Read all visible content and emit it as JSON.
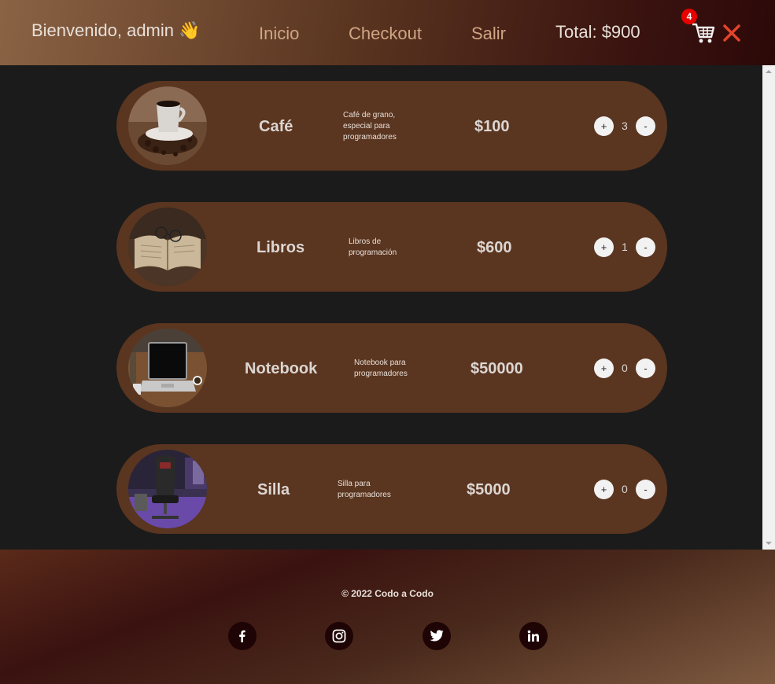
{
  "header": {
    "welcome": "Bienvenido, admin 👋",
    "nav": [
      "Inicio",
      "Checkout",
      "Salir"
    ],
    "total": "Total: $900",
    "cart_count": "4"
  },
  "products": [
    {
      "name": "Café",
      "description": "Café de grano, especial para programadores",
      "price": "$100",
      "qty": "3",
      "image": "coffee-cup-image"
    },
    {
      "name": "Libros",
      "description": "Libros de programación",
      "price": "$600",
      "qty": "1",
      "image": "open-book-image"
    },
    {
      "name": "Notebook",
      "description": "Notebook para programadores",
      "price": "$50000",
      "qty": "0",
      "image": "laptop-image"
    },
    {
      "name": "Silla",
      "description": "Silla para programadores",
      "price": "$5000",
      "qty": "0",
      "image": "gaming-chair-image"
    }
  ],
  "buttons": {
    "plus": "+",
    "minus": "-"
  },
  "footer": {
    "copyright": "© 2022 Codo a Codo",
    "social": [
      "facebook-icon",
      "instagram-icon",
      "twitter-icon",
      "linkedin-icon"
    ]
  },
  "colors": {
    "card": "#5a3520",
    "background": "#1b1b1b",
    "badge": "#e60000",
    "close": "#e2442a",
    "nav_link": "#d0a585"
  }
}
